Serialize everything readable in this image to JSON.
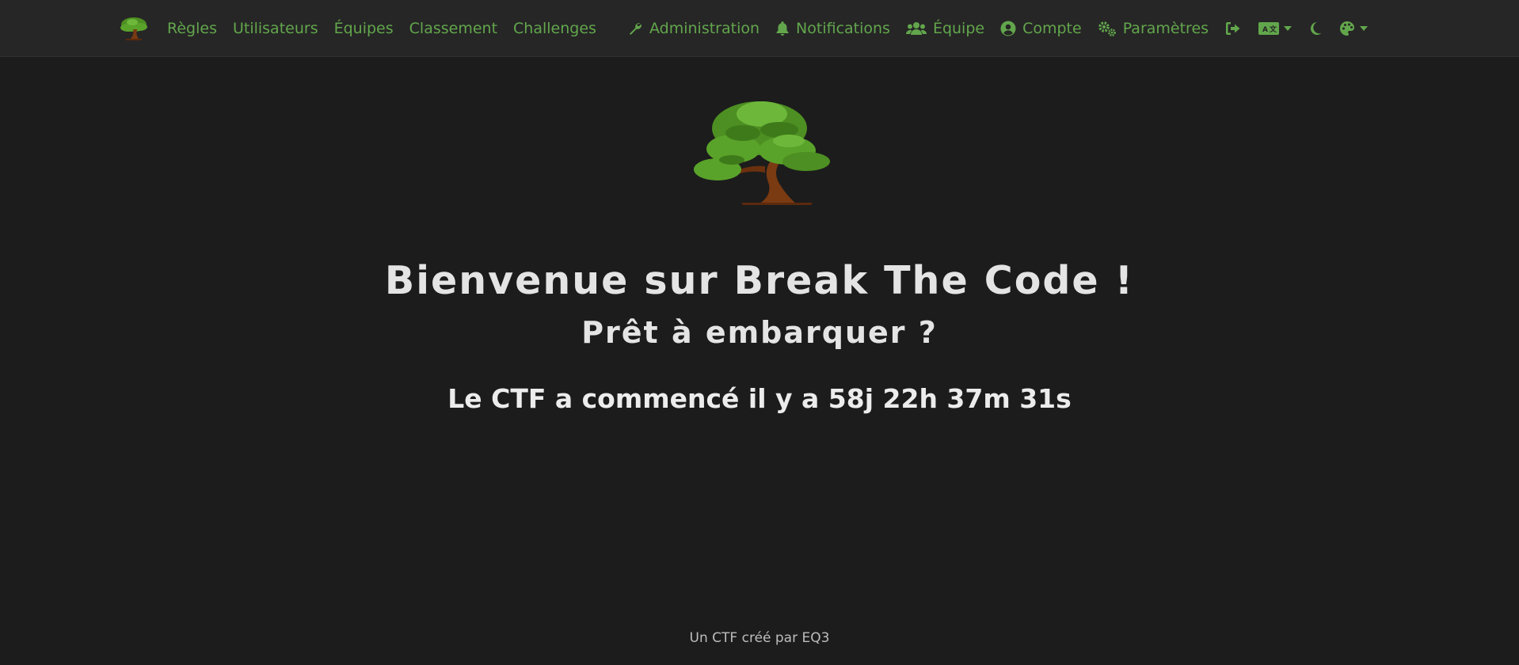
{
  "colors": {
    "background": "#1c1c1c",
    "navbar": "#262626",
    "accent": "#62a64c",
    "text": "#e4e4e4"
  },
  "nav": {
    "brand_icon": "bonsai-tree-logo",
    "left": [
      {
        "label": "Règles"
      },
      {
        "label": "Utilisateurs"
      },
      {
        "label": "Équipes"
      },
      {
        "label": "Classement"
      },
      {
        "label": "Challenges"
      }
    ],
    "right": [
      {
        "label": "Administration",
        "icon": "wrench-icon"
      },
      {
        "label": "Notifications",
        "icon": "bell-icon"
      },
      {
        "label": "Équipe",
        "icon": "users-icon"
      },
      {
        "label": "Compte",
        "icon": "user-circle-icon"
      },
      {
        "label": "Paramètres",
        "icon": "gears-icon"
      }
    ],
    "icons": [
      "logout-icon",
      "language-icon",
      "moon-icon",
      "palette-icon"
    ]
  },
  "hero": {
    "title": "Bienvenue sur Break The Code !",
    "subtitle": "Prêt à embarquer ?",
    "countdown": "Le CTF a commencé il y a 58j 22h 37m 31s"
  },
  "footer": {
    "text": "Un CTF créé par EQ3"
  }
}
